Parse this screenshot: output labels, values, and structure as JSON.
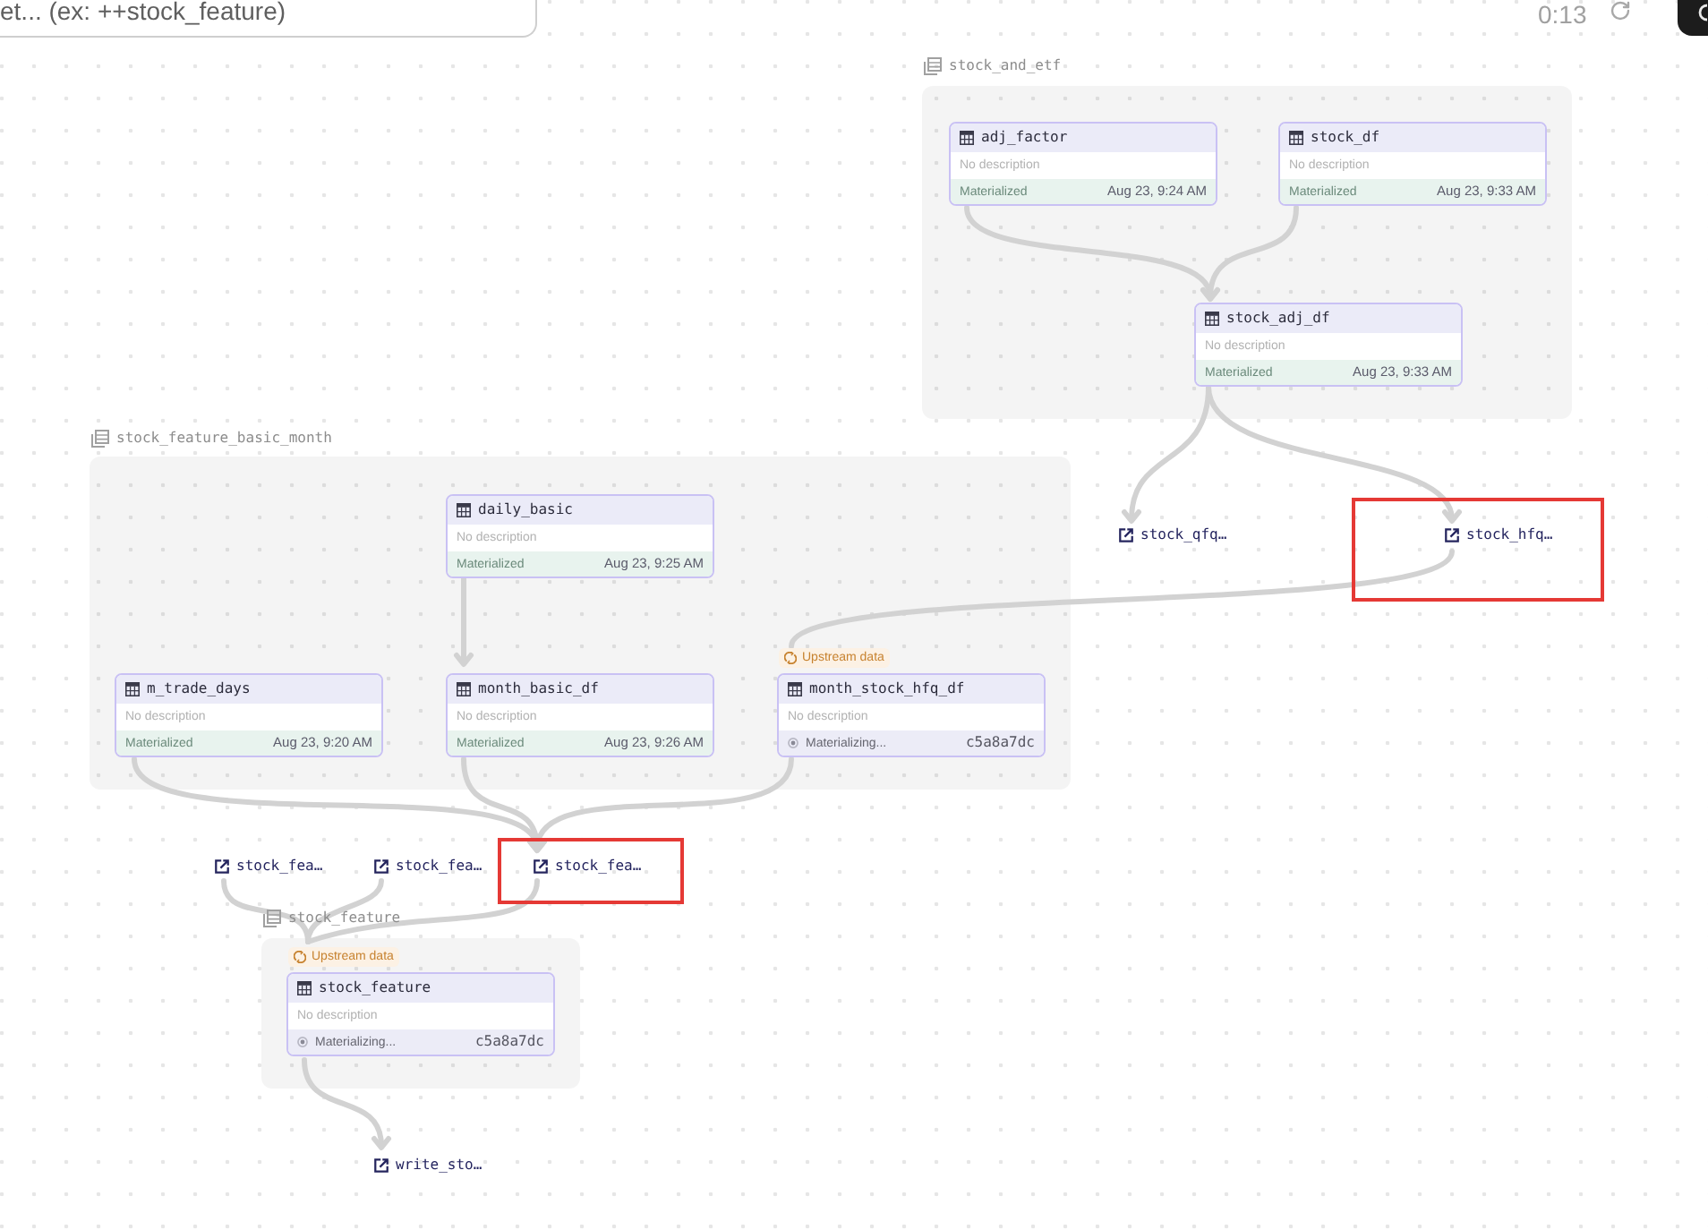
{
  "search": {
    "placeholder": "et... (ex: ++stock_feature)"
  },
  "toolbar": {
    "timer": "0:13"
  },
  "groups": [
    {
      "name": "stock_and_etf",
      "assets": [
        {
          "name": "adj_factor",
          "description": "No description",
          "kind": "materialized",
          "status_label": "Materialized",
          "detail": "Aug 23, 9:24 AM"
        },
        {
          "name": "stock_df",
          "description": "No description",
          "kind": "materialized",
          "status_label": "Materialized",
          "detail": "Aug 23, 9:33 AM"
        },
        {
          "name": "stock_adj_df",
          "description": "No description",
          "kind": "materialized",
          "status_label": "Materialized",
          "detail": "Aug 23, 9:33 AM"
        }
      ]
    },
    {
      "name": "stock_feature_basic_month",
      "assets": [
        {
          "name": "daily_basic",
          "description": "No description",
          "kind": "materialized",
          "status_label": "Materialized",
          "detail": "Aug 23, 9:25 AM"
        },
        {
          "name": "m_trade_days",
          "description": "No description",
          "kind": "materialized",
          "status_label": "Materialized",
          "detail": "Aug 23, 9:20 AM"
        },
        {
          "name": "month_basic_df",
          "description": "No description",
          "kind": "materialized",
          "status_label": "Materialized",
          "detail": "Aug 23, 9:26 AM"
        },
        {
          "name": "month_stock_hfq_df",
          "badge": "Upstream data",
          "description": "No description",
          "kind": "materializing",
          "status_label": "Materializing...",
          "detail": "c5a8a7dc"
        }
      ]
    },
    {
      "name": "stock_feature",
      "assets": [
        {
          "name": "stock_feature",
          "badge": "Upstream data",
          "description": "No description",
          "kind": "materializing",
          "status_label": "Materializing...",
          "detail": "c5a8a7dc"
        }
      ]
    }
  ],
  "external_assets": [
    {
      "name": "stock_qfq…",
      "highlighted": false
    },
    {
      "name": "stock_hfq…",
      "highlighted": true
    },
    {
      "name": "stock_fea…",
      "highlighted": false
    },
    {
      "name": "stock_fea…",
      "highlighted": false
    },
    {
      "name": "stock_fea…",
      "highlighted": true
    },
    {
      "name": "write_sto…",
      "highlighted": false
    }
  ]
}
